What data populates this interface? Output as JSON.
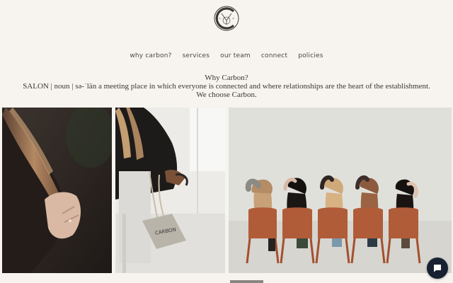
{
  "logo": {
    "icon": "carbon-logo-icon"
  },
  "nav": {
    "items": [
      {
        "label": "why carbon?"
      },
      {
        "label": "services"
      },
      {
        "label": "our team"
      },
      {
        "label": "connect"
      },
      {
        "label": "policies"
      }
    ]
  },
  "intro": {
    "heading": "Why Carbon?",
    "definition": "SALON | noun | sə-ˈlän a meeting place in which everyone is connected and where relationships are the heart of the establishment.",
    "tagline": "We choose Carbon."
  },
  "gallery": {
    "photos": [
      {
        "icon": "hair-closeup-photo"
      },
      {
        "icon": "tote-bag-photo",
        "bag_text": "CARBON"
      },
      {
        "icon": "women-seated-photo"
      }
    ]
  },
  "chat": {
    "icon": "chat-icon"
  },
  "colors": {
    "background": "#f7f4ef",
    "chat_button": "#172131",
    "text": "#3a3733"
  }
}
